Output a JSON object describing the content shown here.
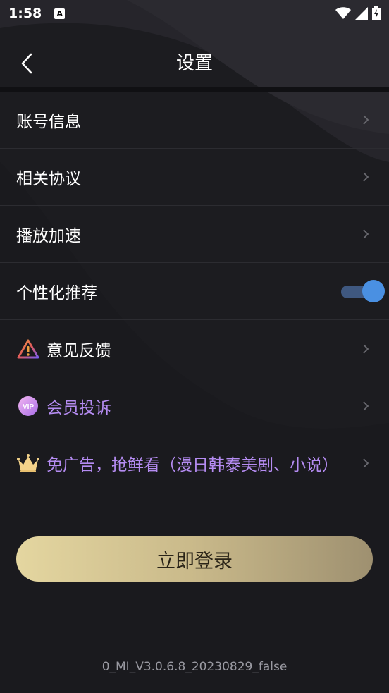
{
  "status_bar": {
    "time": "1:58",
    "notification_badge": "A"
  },
  "header": {
    "title": "设置"
  },
  "settings": {
    "items": [
      {
        "label": "账号信息",
        "icon": "chevron-right-icon"
      },
      {
        "label": "相关协议",
        "icon": "chevron-right-icon"
      },
      {
        "label": "播放加速",
        "icon": "chevron-right-icon"
      },
      {
        "label": "个性化推荐",
        "toggle_on": true
      },
      {
        "label": "意见反馈",
        "icon": "warning-triangle-icon"
      },
      {
        "label": "会员投诉",
        "icon": "vip-badge-icon"
      },
      {
        "label": "免广告，抢鲜看（漫日韩泰美剧、小说）",
        "icon": "crown-icon"
      }
    ]
  },
  "login_button": {
    "label": "立即登录"
  },
  "version": "0_MI_V3.0.6.8_20230829_false",
  "colors": {
    "background": "#1c1c20",
    "accent_purple": "#b58cf2",
    "toggle_blue": "#4a90e2",
    "button_gold": "#e4d6a0"
  }
}
